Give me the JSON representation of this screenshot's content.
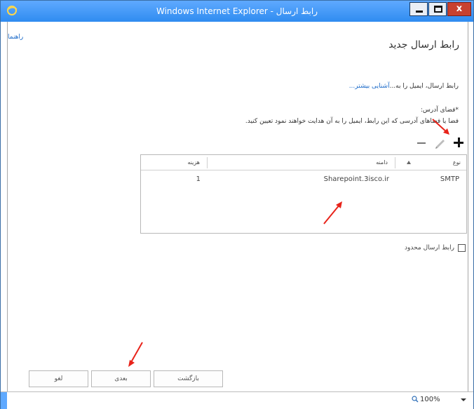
{
  "window": {
    "title": "Windows Internet Explorer - رابط ارسال"
  },
  "page": {
    "help_link": "راهنما",
    "heading": "رابط ارسال جدید",
    "intro_text": "رابط ارسال، ایمیل را به...",
    "learn_more": "آشنایی بیشتر...",
    "address_space_label": "*فضای آدرس:",
    "address_space_desc": "فضا یا فضاهای آدرسی که این رابط، ایمیل را به آن هدایت خواهند نمود تعیین کنید."
  },
  "toolbar": {
    "icons": [
      "plus-icon",
      "pencil-icon",
      "minus-icon"
    ]
  },
  "grid": {
    "headers": {
      "type": "نوع",
      "domain": "دامنه",
      "cost": "هزینه"
    },
    "rows": [
      {
        "type": "SMTP",
        "domain": "Sharepoint.3isco.ir",
        "cost": "1"
      }
    ]
  },
  "options": {
    "scoped_label": "رابط ارسال محدود",
    "scoped_checked": false
  },
  "buttons": {
    "back": "بازگشت",
    "next": "بعدی",
    "cancel": "لغو"
  },
  "statusbar": {
    "zoom": "100%"
  },
  "colors": {
    "titlebar": "#2f8cf0",
    "link": "#1b6ac9",
    "annotation": "#e8231a"
  }
}
